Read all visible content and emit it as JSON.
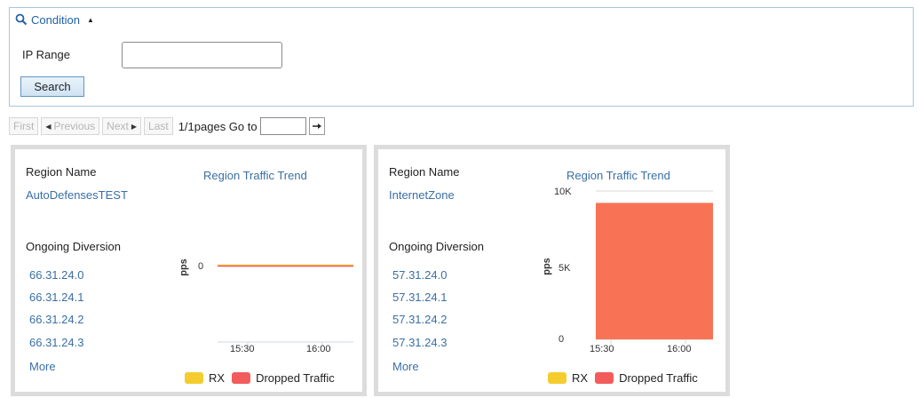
{
  "condition": {
    "title": "Condition",
    "ip_range_label": "IP Range",
    "ip_range_value": "",
    "search_label": "Search"
  },
  "pager": {
    "first": "First",
    "previous": "Previous",
    "next": "Next",
    "last": "Last",
    "info": "1/1pages Go to",
    "goto_value": ""
  },
  "cards": [
    {
      "region_name_label": "Region Name",
      "region_name": "AutoDefensesTEST",
      "trend_label": "Region Traffic Trend",
      "diversion_label": "Ongoing Diversion",
      "ips": [
        "66.31.24.0",
        "66.31.24.1",
        "66.31.24.2",
        "66.31.24.3"
      ],
      "more_label": "More"
    },
    {
      "region_name_label": "Region Name",
      "region_name": "InternetZone",
      "trend_label": "Region Traffic Trend",
      "diversion_label": "Ongoing Diversion",
      "ips": [
        "57.31.24.0",
        "57.31.24.1",
        "57.31.24.2",
        "57.31.24.3"
      ],
      "more_label": "More"
    }
  ],
  "legend": {
    "rx_label": "RX",
    "dropped_label": "Dropped Traffic",
    "rx_color": "#f5cc2e",
    "dropped_color": "#f25c5c"
  },
  "chart_data": [
    {
      "type": "line",
      "title": "Region Traffic Trend",
      "ylabel": "pps",
      "yticks": [
        "0"
      ],
      "xticks": [
        "15:30",
        "16:00"
      ],
      "series": [
        {
          "name": "RX",
          "color": "#f5cc2e",
          "values": [
            0,
            0
          ]
        },
        {
          "name": "Dropped Traffic",
          "color": "#f25c5c",
          "values": [
            0,
            0
          ]
        }
      ],
      "legend_position": "bottom"
    },
    {
      "type": "area",
      "title": "Region Traffic Trend",
      "ylabel": "pps",
      "yticks": [
        "0",
        "5K",
        "10K"
      ],
      "ylim": [
        0,
        10000
      ],
      "xticks": [
        "15:30",
        "16:00"
      ],
      "series": [
        {
          "name": "RX",
          "color": "#f5cc2e",
          "values": [
            0,
            0
          ]
        },
        {
          "name": "Dropped Traffic",
          "color": "#f87355",
          "values": [
            9200,
            9200
          ]
        }
      ],
      "legend_position": "bottom"
    }
  ]
}
